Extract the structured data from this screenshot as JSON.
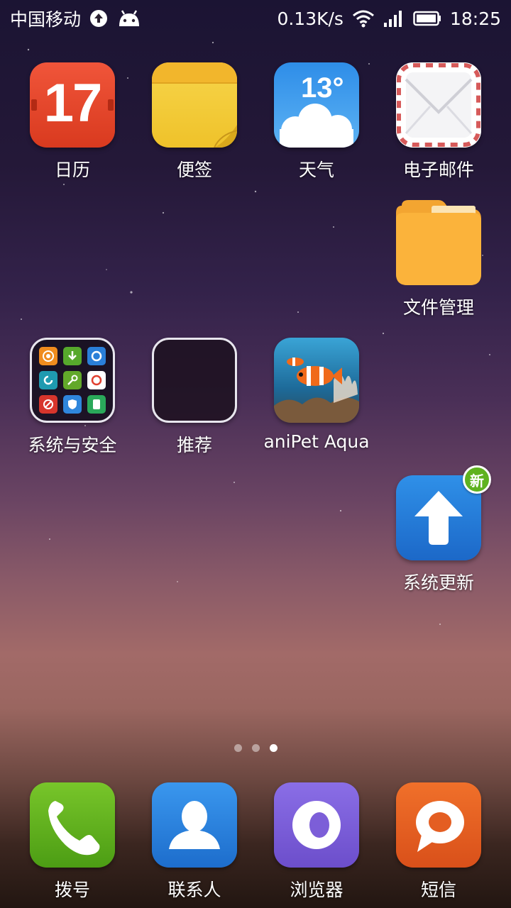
{
  "status_bar": {
    "carrier": "中国移动",
    "net_speed": "0.13K/s",
    "time": "18:25"
  },
  "apps": {
    "calendar": {
      "label": "日历",
      "day": "17"
    },
    "notes": {
      "label": "便签"
    },
    "weather": {
      "label": "天气",
      "temp": "13°"
    },
    "email": {
      "label": "电子邮件"
    },
    "files": {
      "label": "文件管理"
    },
    "security_folder": {
      "label": "系统与安全"
    },
    "recommend_folder": {
      "label": "推荐"
    },
    "aquarium": {
      "label": "aniPet Aqua"
    },
    "system_update": {
      "label": "系统更新",
      "badge": "新"
    }
  },
  "page_indicator": {
    "pages": 3,
    "current": 3
  },
  "dock": {
    "phone": {
      "label": "拨号"
    },
    "contacts": {
      "label": "联系人"
    },
    "browser": {
      "label": "浏览器"
    },
    "sms": {
      "label": "短信"
    }
  },
  "colors": {
    "calendar": "#e4472b",
    "notes": "#f2c93a",
    "weather": "#3b98ec",
    "update": "#2a80dc",
    "badge": "#5fb21f",
    "phone": "#5fae1c",
    "contacts": "#2a85e0",
    "browser": "#7c5ed8",
    "sms": "#e45e22"
  }
}
